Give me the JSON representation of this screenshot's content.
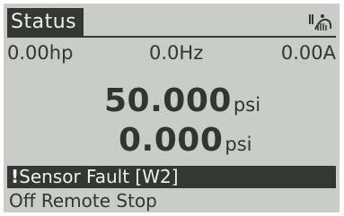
{
  "header": {
    "title": "Status",
    "icon": "hand-auto-mode-icon"
  },
  "readouts": {
    "power": "0.00hp",
    "frequency": "0.0Hz",
    "current": "0.00A"
  },
  "main": {
    "value1": {
      "number": "50.000",
      "unit": "psi"
    },
    "value2": {
      "number": "0.000",
      "unit": "psi"
    }
  },
  "alarm": {
    "icon": "warning-icon",
    "text": "Sensor Fault [W2]"
  },
  "state": {
    "text": "Off Remote Stop"
  },
  "colors": {
    "lcd_background": "#c9ccc8",
    "lcd_foreground": "#353735",
    "inverse_text": "#ecefec"
  }
}
